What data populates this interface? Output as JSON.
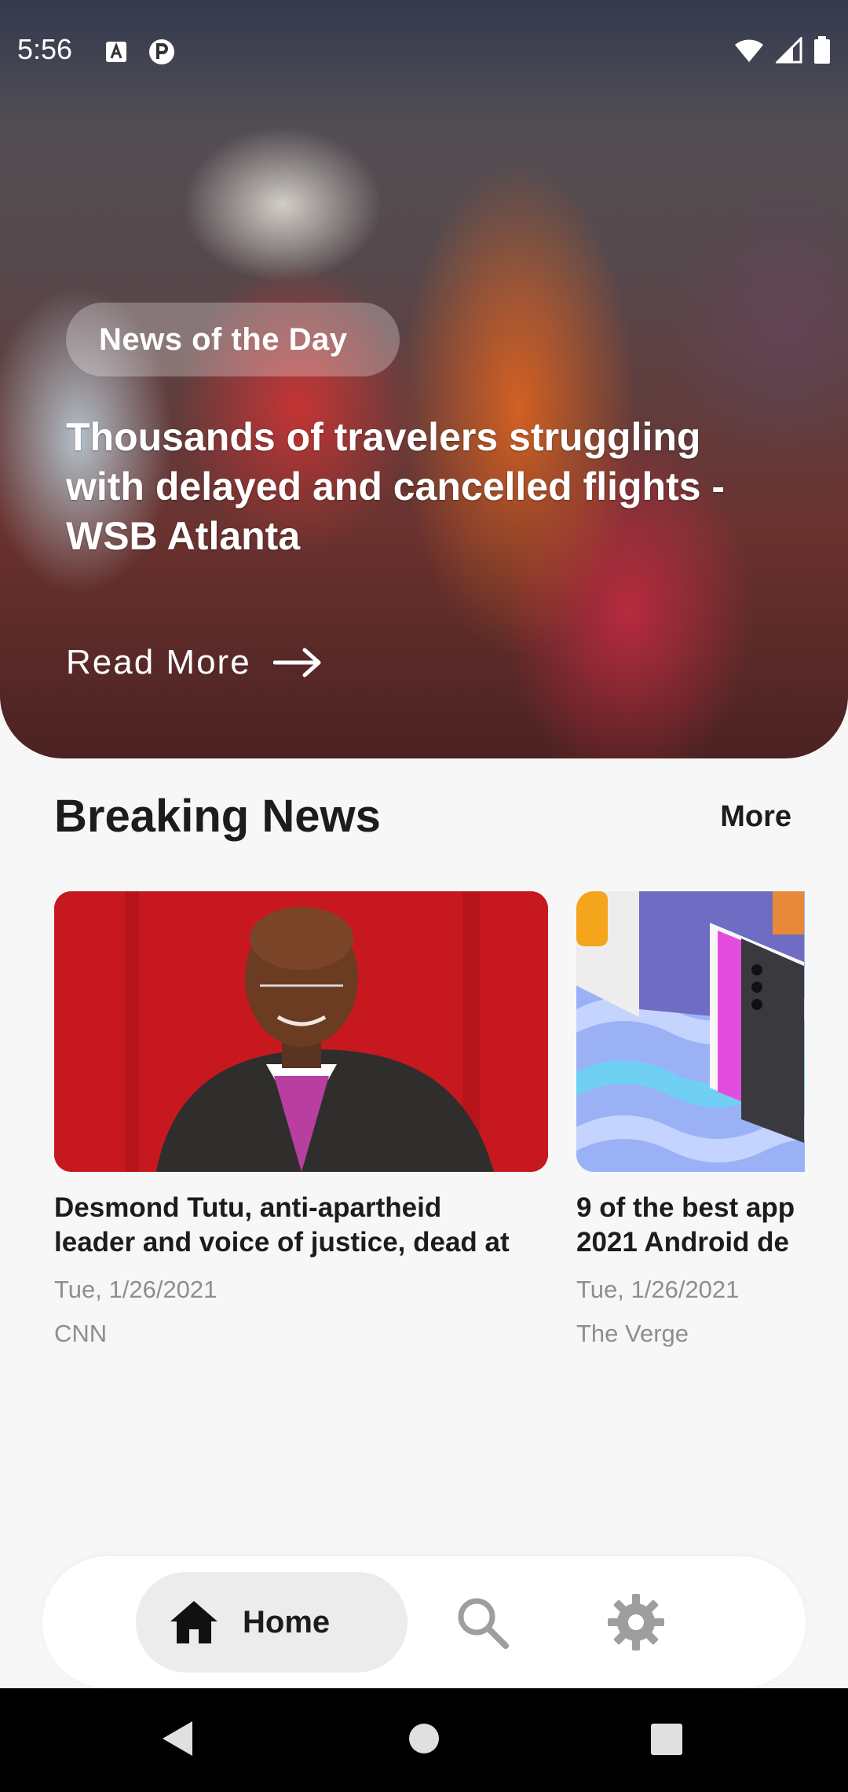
{
  "status_bar": {
    "time": "5:56",
    "icons_left": [
      "a-badge-icon",
      "p-circle-icon"
    ],
    "icons_right": [
      "wifi-icon",
      "signal-icon",
      "battery-icon"
    ]
  },
  "hero": {
    "tag": "News of the Day",
    "title": "Thousands of travelers struggling with delayed and cancelled flights - WSB Atlanta",
    "read_more": "Read More"
  },
  "breaking": {
    "title": "Breaking News",
    "more": "More",
    "cards": [
      {
        "headline_line1": "Desmond Tutu, anti-apartheid",
        "headline_line2": "leader and voice of justice, dead at",
        "date": "Tue, 1/26/2021",
        "source": "CNN"
      },
      {
        "headline_line1": "9 of the best app",
        "headline_line2": "2021 Android de",
        "date": "Tue, 1/26/2021",
        "source": "The Verge"
      }
    ]
  },
  "bottom_nav": {
    "home": "Home",
    "items": [
      "home-icon",
      "search-icon",
      "gear-icon"
    ]
  },
  "colors": {
    "background": "#f7f7f7",
    "text_primary": "#1c1c1c",
    "text_secondary": "#8e8e8e",
    "nav_active": "#ececec",
    "nav_icon_inactive": "#9e9e9e"
  }
}
